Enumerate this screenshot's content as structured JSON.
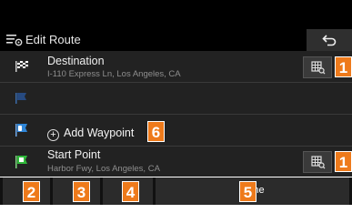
{
  "header": {
    "title": "Edit Route",
    "title_icon": "route-edit-icon",
    "back_icon": "back-arrow-icon"
  },
  "rows": {
    "destination": {
      "label": "Destination",
      "address": "I-110 Express Ln, Los Angeles, CA",
      "flag_icon": "checkered-flag-icon"
    },
    "waypoint_empty": {
      "flag_icon": "blue-flag-icon"
    },
    "add_waypoint": {
      "label": "Add Waypoint",
      "flag_icon": "numbered-blue-flag-icon"
    },
    "start": {
      "label": "Start Point",
      "address": "Harbor Fwy, Los Angeles, CA",
      "flag_icon": "green-start-flag-icon"
    }
  },
  "map_buttons": {
    "icon": "map-search-icon"
  },
  "toolbar": {
    "done_label": "Done"
  },
  "badges": {
    "b1": "1",
    "b1b": "1",
    "b2": "2",
    "b3": "3",
    "b4": "4",
    "b5": "5",
    "b6": "6"
  },
  "colors": {
    "accent": "#ee7a1b",
    "background": "#222222"
  }
}
